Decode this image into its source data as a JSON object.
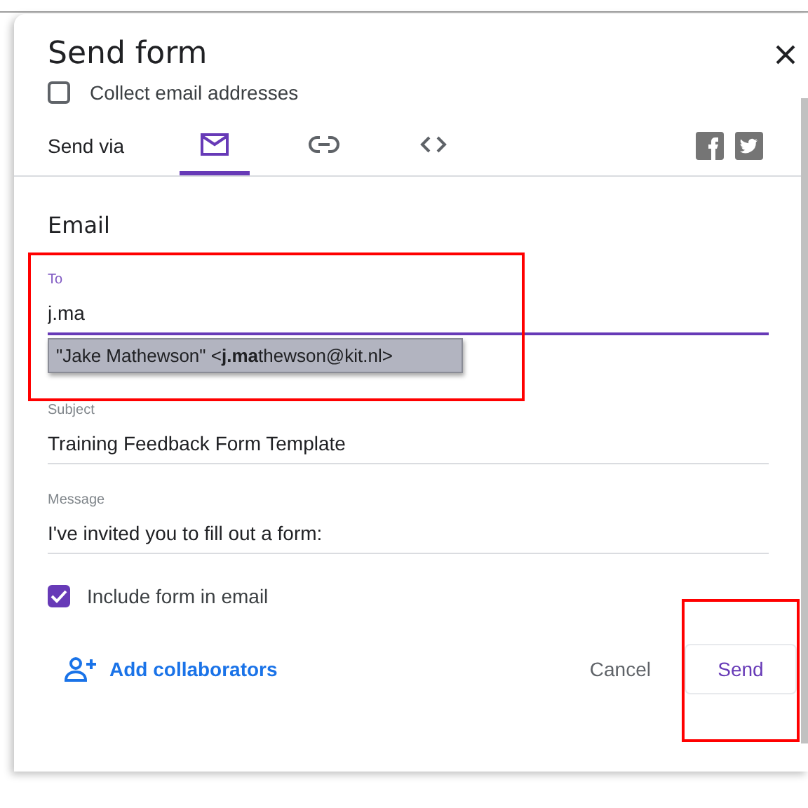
{
  "dialog": {
    "title": "Send form"
  },
  "collect_email": {
    "label": "Collect email addresses",
    "checked": false
  },
  "send_via": {
    "label": "Send via",
    "tabs": [
      {
        "kind": "email",
        "selected": true
      },
      {
        "kind": "link",
        "selected": false
      },
      {
        "kind": "embed",
        "selected": false
      }
    ],
    "share": [
      {
        "kind": "facebook"
      },
      {
        "kind": "twitter"
      }
    ]
  },
  "section_title": "Email",
  "to": {
    "label": "To",
    "value": "j.ma",
    "focused": true,
    "highlighted": true,
    "suggestion": "\"Jake Mathewson\" <**j.ma**thewson@kit.nl>"
  },
  "subject": {
    "label": "Subject",
    "value": "Training Feedback Form Template"
  },
  "message": {
    "label": "Message",
    "value": "I've invited you to fill out a form:"
  },
  "include_form": {
    "label": "Include form in email",
    "checked": true
  },
  "add_collaborators": "Add collaborators",
  "buttons": [
    {
      "kind": "text",
      "label": "Cancel",
      "highlighted": false
    },
    {
      "kind": "outlined",
      "label": "Send",
      "highlighted": true
    }
  ]
}
